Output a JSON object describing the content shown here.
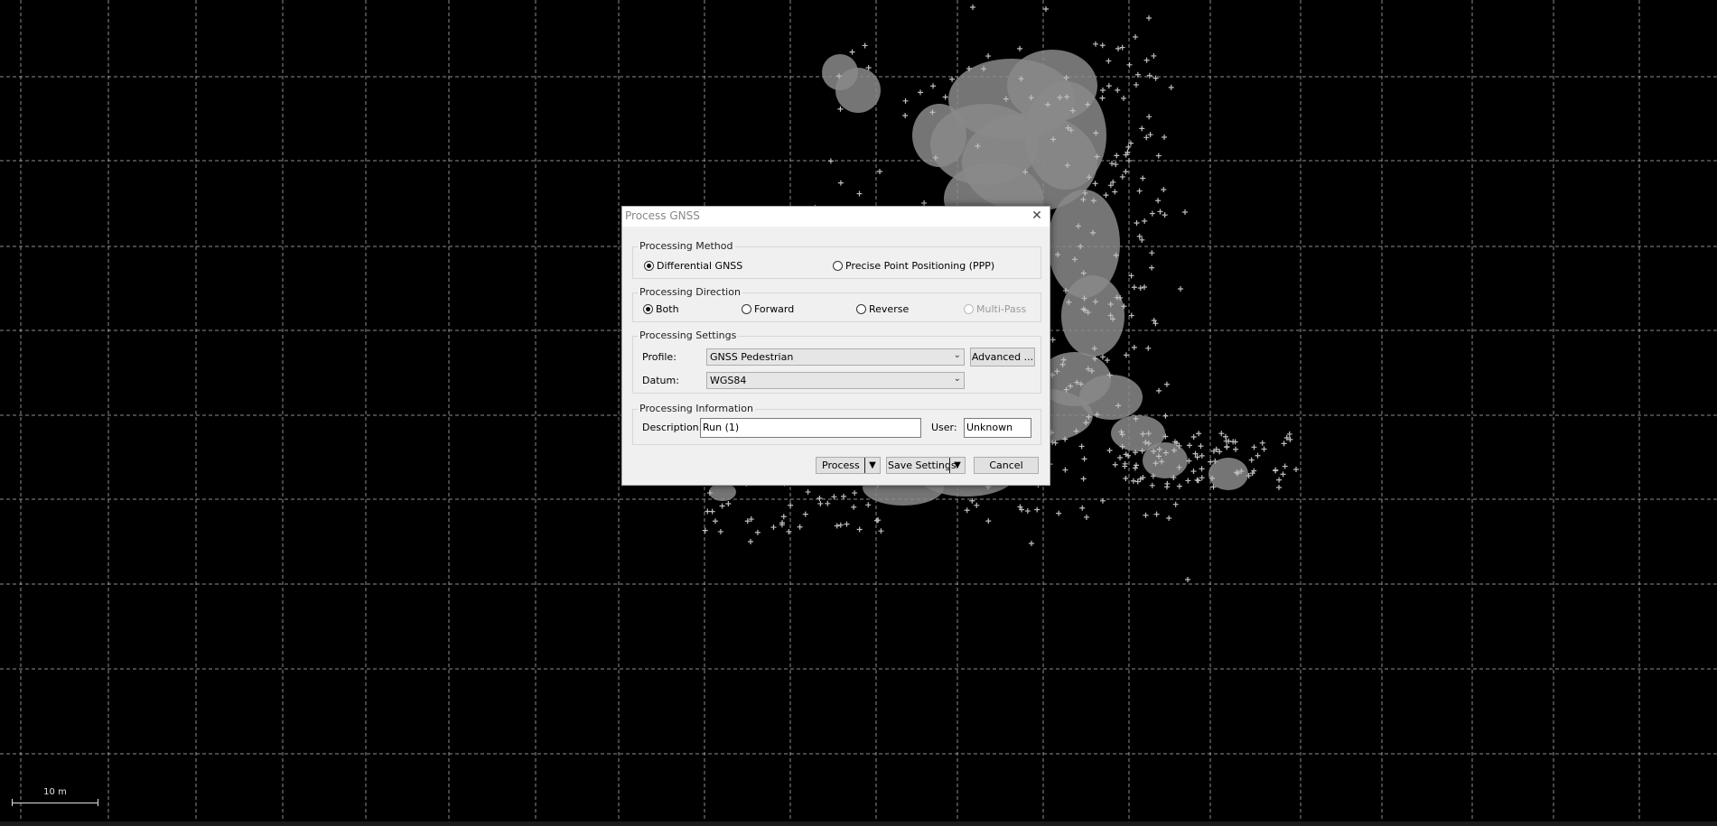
{
  "map": {
    "scale_label": "10 m",
    "point_color": "#8a8a8a",
    "background_color": "#000000",
    "grid_color": "#bdbdbd"
  },
  "dialog": {
    "title": "Process GNSS",
    "close_icon": "close-icon",
    "processing_method": {
      "label": "Processing Method",
      "options": [
        {
          "label": "Differential GNSS",
          "selected": true
        },
        {
          "label": "Precise Point Positioning (PPP)",
          "selected": false
        }
      ]
    },
    "processing_direction": {
      "label": "Processing Direction",
      "options": [
        {
          "label": "Both",
          "selected": true,
          "enabled": true
        },
        {
          "label": "Forward",
          "selected": false,
          "enabled": true
        },
        {
          "label": "Reverse",
          "selected": false,
          "enabled": true
        },
        {
          "label": "Multi-Pass",
          "selected": false,
          "enabled": false
        }
      ]
    },
    "processing_settings": {
      "label": "Processing Settings",
      "profile_label": "Profile:",
      "profile_value": "GNSS Pedestrian",
      "advanced_button": "Advanced ...",
      "datum_label": "Datum:",
      "datum_value": "WGS84"
    },
    "processing_information": {
      "label": "Processing Information",
      "description_label": "Description:",
      "description_value": "Run (1)",
      "user_label": "User:",
      "user_value": "Unknown"
    },
    "buttons": {
      "process": "Process",
      "save_settings": "Save Settings",
      "cancel": "Cancel"
    }
  }
}
